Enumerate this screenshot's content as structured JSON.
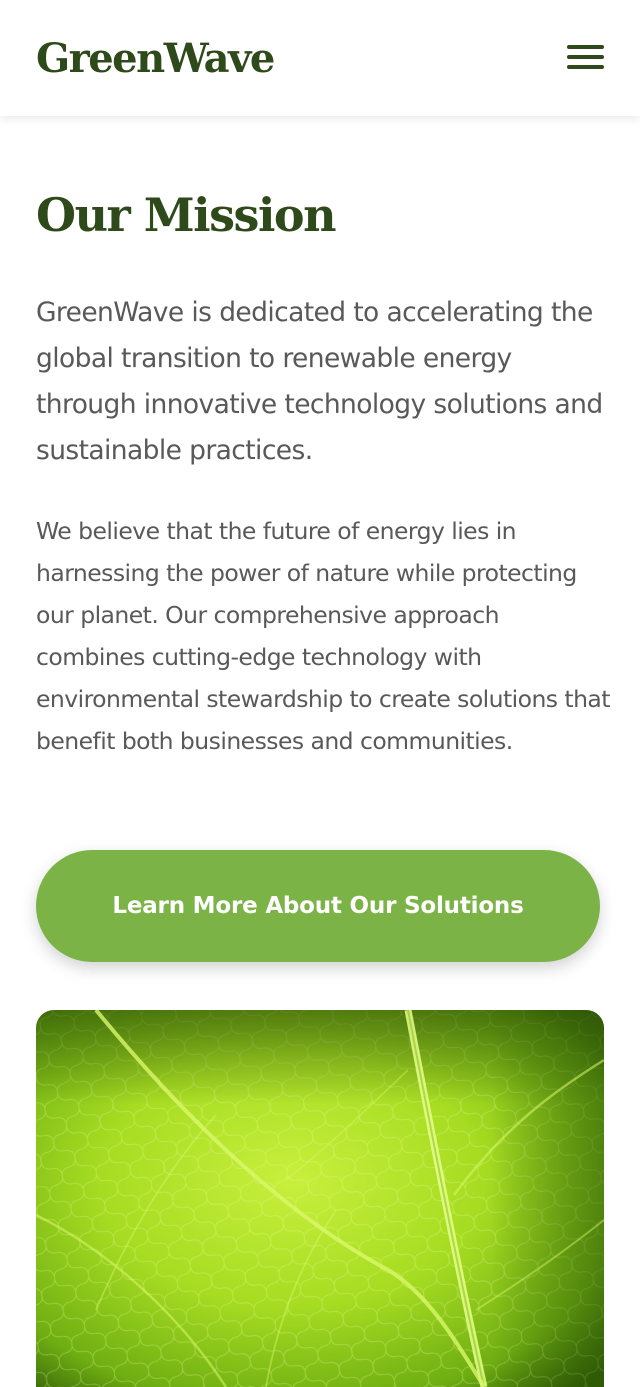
{
  "header": {
    "logo": "GreenWave",
    "menu_icon": "hamburger-menu-icon"
  },
  "main": {
    "title": "Our Mission",
    "lead": "GreenWave is dedicated to accelerating the global transition to renewable energy through innovative technology solutions and sustainable practices.",
    "body": "We believe that the future of energy lies in harnessing the power of nature while protecting our planet. Our comprehensive approach combines cutting-edge technology with environmental stewardship to create solutions that benefit both businesses and communities.",
    "cta_label": "Learn More About Our Solutions"
  },
  "colors": {
    "brand_dark_green": "#2e4a1a",
    "accent_green": "#7cb347",
    "text_gray": "#595959"
  }
}
